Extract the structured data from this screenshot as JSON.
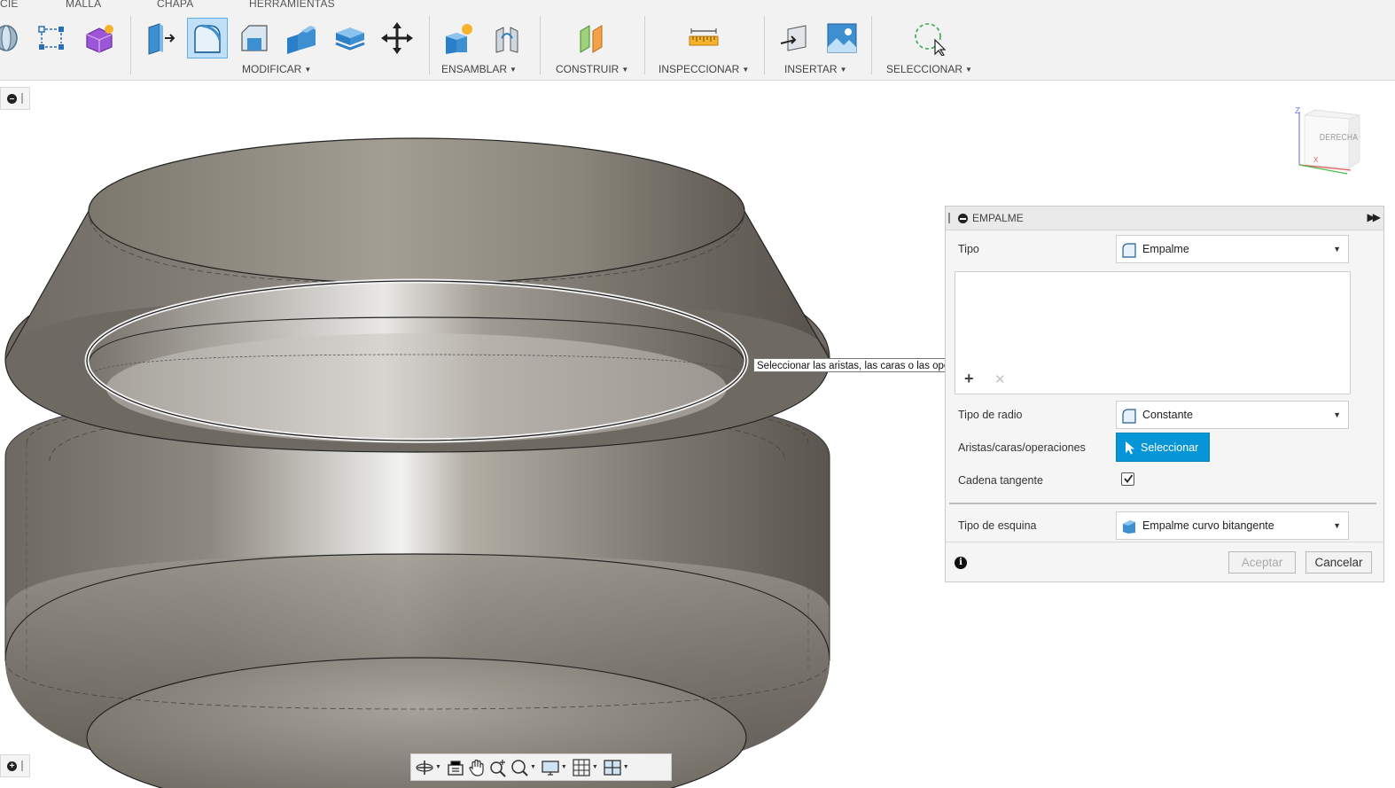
{
  "ribbon": {
    "tabs": [
      "CIE",
      "MALLA",
      "CHAPA",
      "HERRAMIENTAS"
    ],
    "groups": {
      "modify": "MODIFICAR",
      "assemble": "ENSAMBLAR",
      "construct": "CONSTRUIR",
      "inspect": "INSPECCIONAR",
      "insert": "INSERTAR",
      "select": "SELECCIONAR"
    }
  },
  "viewcube": {
    "face": "DERECHA",
    "axis_z": "Z",
    "axis_x": "X"
  },
  "tooltip": "Seleccionar las aristas, las caras o las operaciones para empalmar",
  "dialog": {
    "title": "EMPALME",
    "type_label": "Tipo",
    "type_value": "Empalme",
    "radius_type_label": "Tipo de radio",
    "radius_type_value": "Constante",
    "edges_label": "Aristas/caras/operaciones",
    "select_button": "Seleccionar",
    "tangent_chain_label": "Cadena tangente",
    "tangent_chain_checked": true,
    "corner_type_label": "Tipo de esquina",
    "corner_type_value": "Empalme curvo bitangente",
    "ok_button": "Aceptar",
    "cancel_button": "Cancelar"
  },
  "colors": {
    "accent": "#0696d7",
    "ribbon_bg": "#f2f2f2",
    "model_metal": "#8f8a80"
  }
}
